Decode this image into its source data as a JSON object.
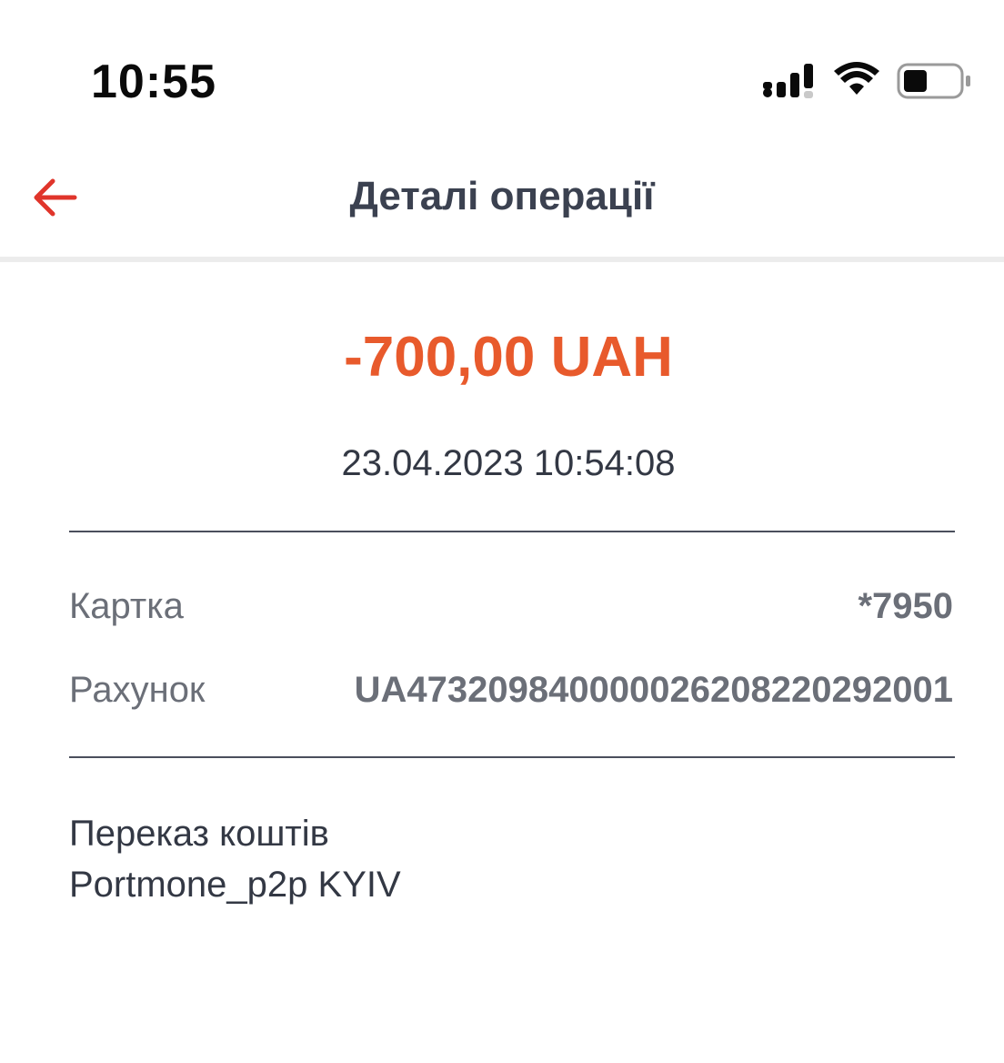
{
  "status_bar": {
    "time": "10:55",
    "signal_icon": "cellular-signal-icon",
    "wifi_icon": "wifi-icon",
    "battery_icon": "battery-icon",
    "battery_level": 0.25
  },
  "header": {
    "back_icon": "arrow-left-icon",
    "title": "Деталі операції",
    "accent_color": "#e0352b"
  },
  "transaction": {
    "amount": "-700,00 UAH",
    "amount_color": "#e85a2c",
    "datetime": "23.04.2023 10:54:08",
    "details": [
      {
        "label": "Картка",
        "value": "*7950"
      },
      {
        "label": "Рахунок",
        "value": "UA473209840000026208220292001"
      }
    ],
    "description_line1": "Переказ коштів",
    "description_line2": "Portmone_p2p KYIV"
  }
}
